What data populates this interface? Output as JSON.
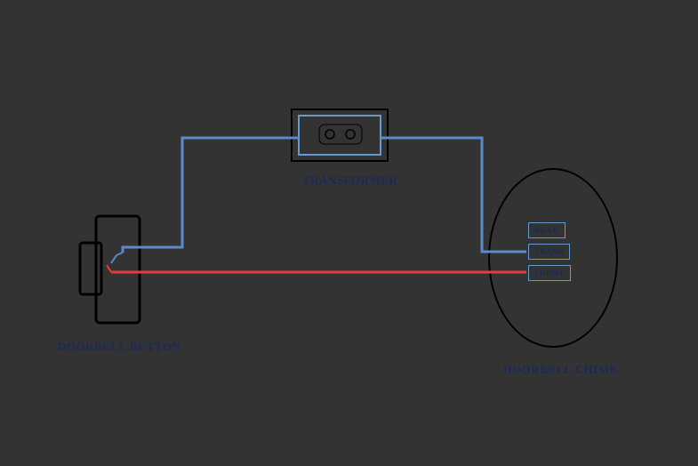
{
  "labels": {
    "transformer": "TRANSFORMER",
    "doorbell_button": "DOORBELL BUTTON",
    "doorbell_chime": "DOORBELL CHIME"
  },
  "terminals": {
    "rear": "REAR",
    "trans": "TRANS",
    "front": "FRONT"
  },
  "wires": {
    "blue_color": "#5a8acc",
    "red_color": "#e04040"
  }
}
